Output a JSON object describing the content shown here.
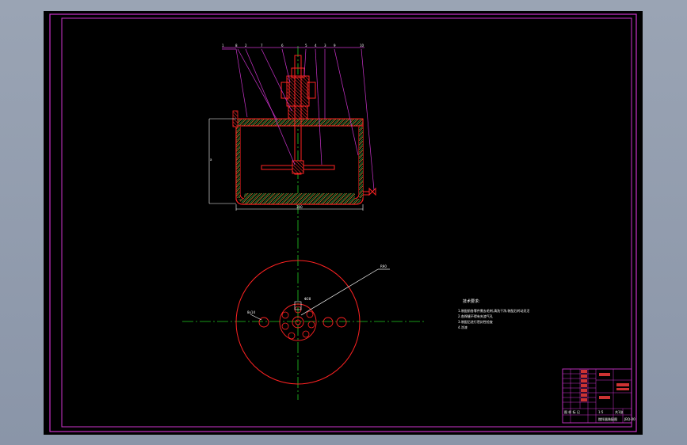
{
  "drawing": {
    "background_color": "#000000",
    "frame_color": "#cc33cc",
    "leader_color": "#cc33cc",
    "section_color": "#ff2222",
    "hatch_color": "#33cc55",
    "centerline_color": "#22cc22",
    "dimension_color": "#ffffff"
  },
  "part_balloons": [
    "1",
    "8",
    "2",
    "7",
    "6",
    "5",
    "4",
    "3",
    "9",
    "10"
  ],
  "dimensions": {
    "height_label": "a",
    "width_label": "300"
  },
  "plan_view": {
    "leader_label": "R90",
    "bolt_hole_label": "8x14",
    "center_label": "Φ28"
  },
  "notes": {
    "heading": "技术要求:",
    "lines": [
      "1.装配前各零件需去毛刺,清洗干净,装配后转动灵活",
      "2.各焊缝不得有夹渣气孔",
      "3.装配后进行密封性检查",
      "4.涂漆"
    ]
  },
  "title_block": {
    "title": "搅拌器装配图",
    "scale": "1:5",
    "sheet": "共1张",
    "drawing_no": "JBQ-00"
  }
}
